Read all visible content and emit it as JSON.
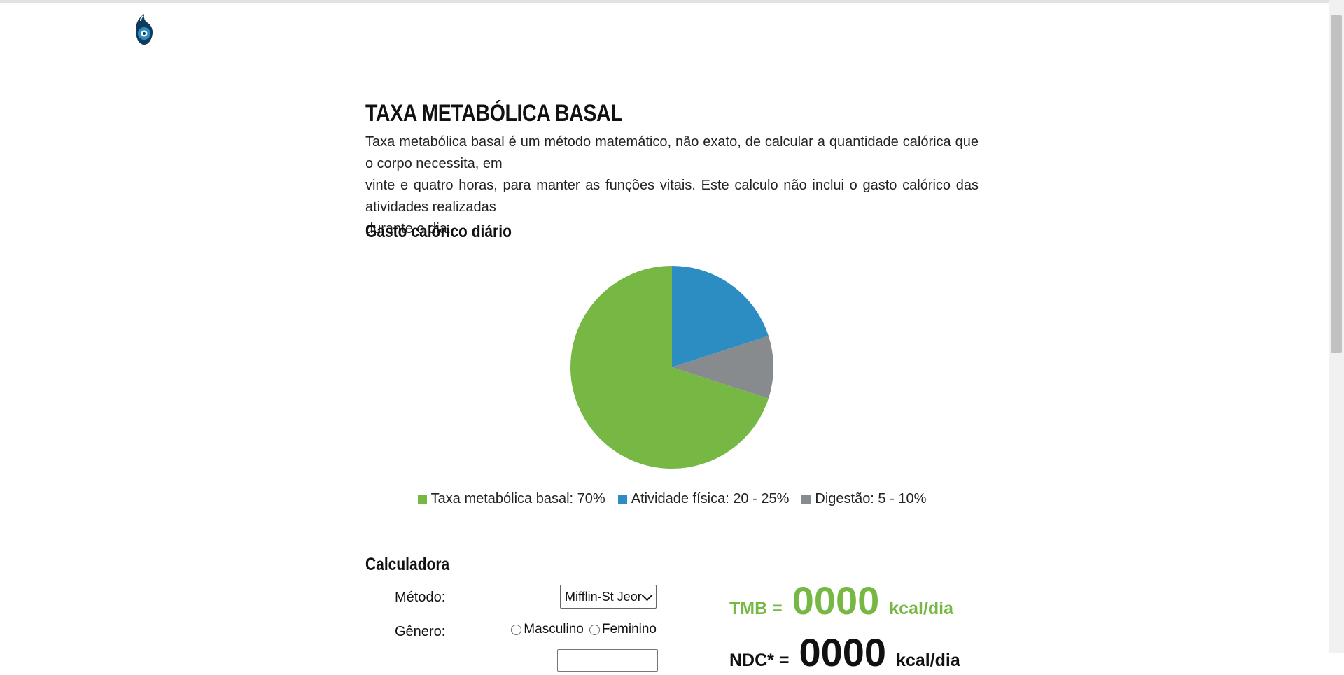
{
  "page": {
    "title": "TAXA METABÓLICA BASAL",
    "intro_lines": [
      "Taxa metabólica basal é um método matemático, não exato, de calcular a quantidade calórica que o corpo necessita, em",
      "vinte e quatro horas, para manter as funções vitais. Este calculo não inclui o gasto calórico das atividades realizadas",
      "durante o dia."
    ]
  },
  "logo": {
    "icon": "flame-drop-logo",
    "color": "#2c79ad"
  },
  "chart_section": {
    "title": "Gasto calórico diário"
  },
  "chart_data": {
    "type": "pie",
    "title": "Gasto calórico diário",
    "slices": [
      {
        "label": "Taxa metabólica basal: 70%",
        "value": 70,
        "color": "#76b843"
      },
      {
        "label": "Atividade física: 20 - 25%",
        "value": 20,
        "color": "#2c8dc2"
      },
      {
        "label": "Digestão: 5 - 10%",
        "value": 10,
        "color": "#878b8e"
      }
    ],
    "legend_position": "bottom"
  },
  "calculator": {
    "title": "Calculadora",
    "method": {
      "label": "Método:",
      "selected": "Mifflin-St Jeor"
    },
    "gender": {
      "label": "Gênero:",
      "options": [
        "Masculino",
        "Feminino"
      ]
    },
    "tmb": {
      "label": "TMB =",
      "value": "0000",
      "unit": "kcal/dia",
      "color": "#76b843"
    },
    "ngr": {
      "label": "NDC* =",
      "value": "0000",
      "unit": "kcal/dia"
    }
  }
}
